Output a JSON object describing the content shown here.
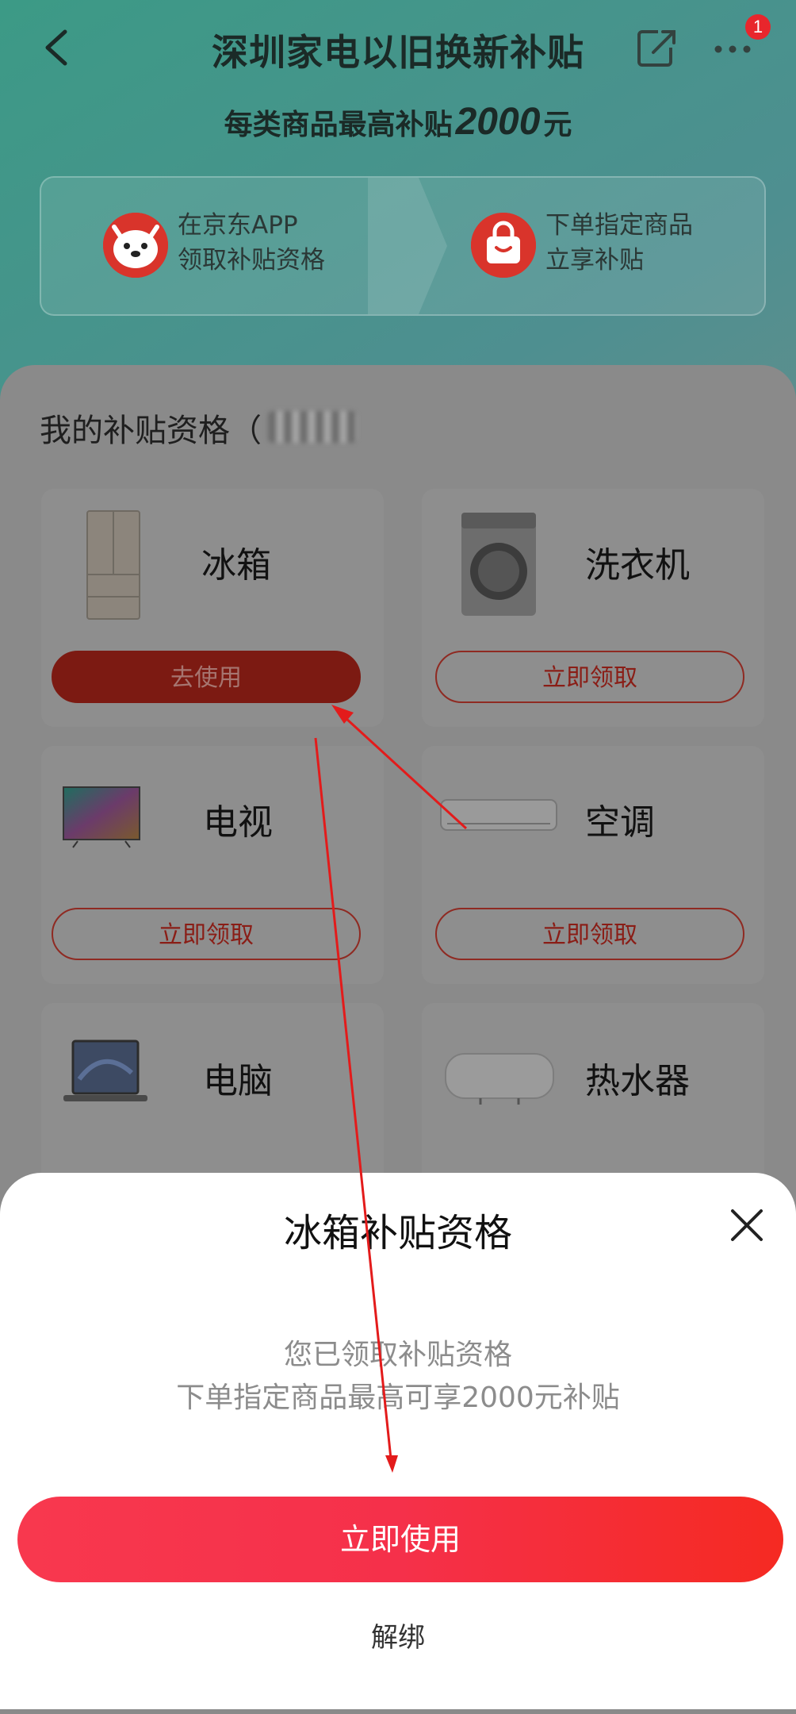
{
  "header": {
    "title": "深圳家电以旧换新补贴",
    "notification_count": "1",
    "subtitle_prefix": "每类商品最高补贴",
    "subtitle_amount": "2000",
    "subtitle_suffix": "元"
  },
  "steps": [
    {
      "line1": "在京东APP",
      "line2": "领取补贴资格"
    },
    {
      "line1": "下单指定商品",
      "line2": "立享补贴"
    }
  ],
  "my_section": {
    "title": "我的补贴资格（"
  },
  "categories": [
    {
      "name": "冰箱",
      "button": "去使用",
      "state": "claimed"
    },
    {
      "name": "洗衣机",
      "button": "立即领取"
    },
    {
      "name": "电视",
      "button": "立即领取"
    },
    {
      "name": "空调",
      "button": "立即领取"
    },
    {
      "name": "电脑",
      "button": ""
    },
    {
      "name": "热水器",
      "button": ""
    }
  ],
  "sheet": {
    "title": "冰箱补贴资格",
    "message_line1": "您已领取补贴资格",
    "message_line2": "下单指定商品最高可享2000元补贴",
    "primary_button": "立即使用",
    "secondary_link": "解绑"
  },
  "colors": {
    "accent": "#f5304a",
    "badge": "#e8262c",
    "sheet_background": "#ffffff"
  }
}
